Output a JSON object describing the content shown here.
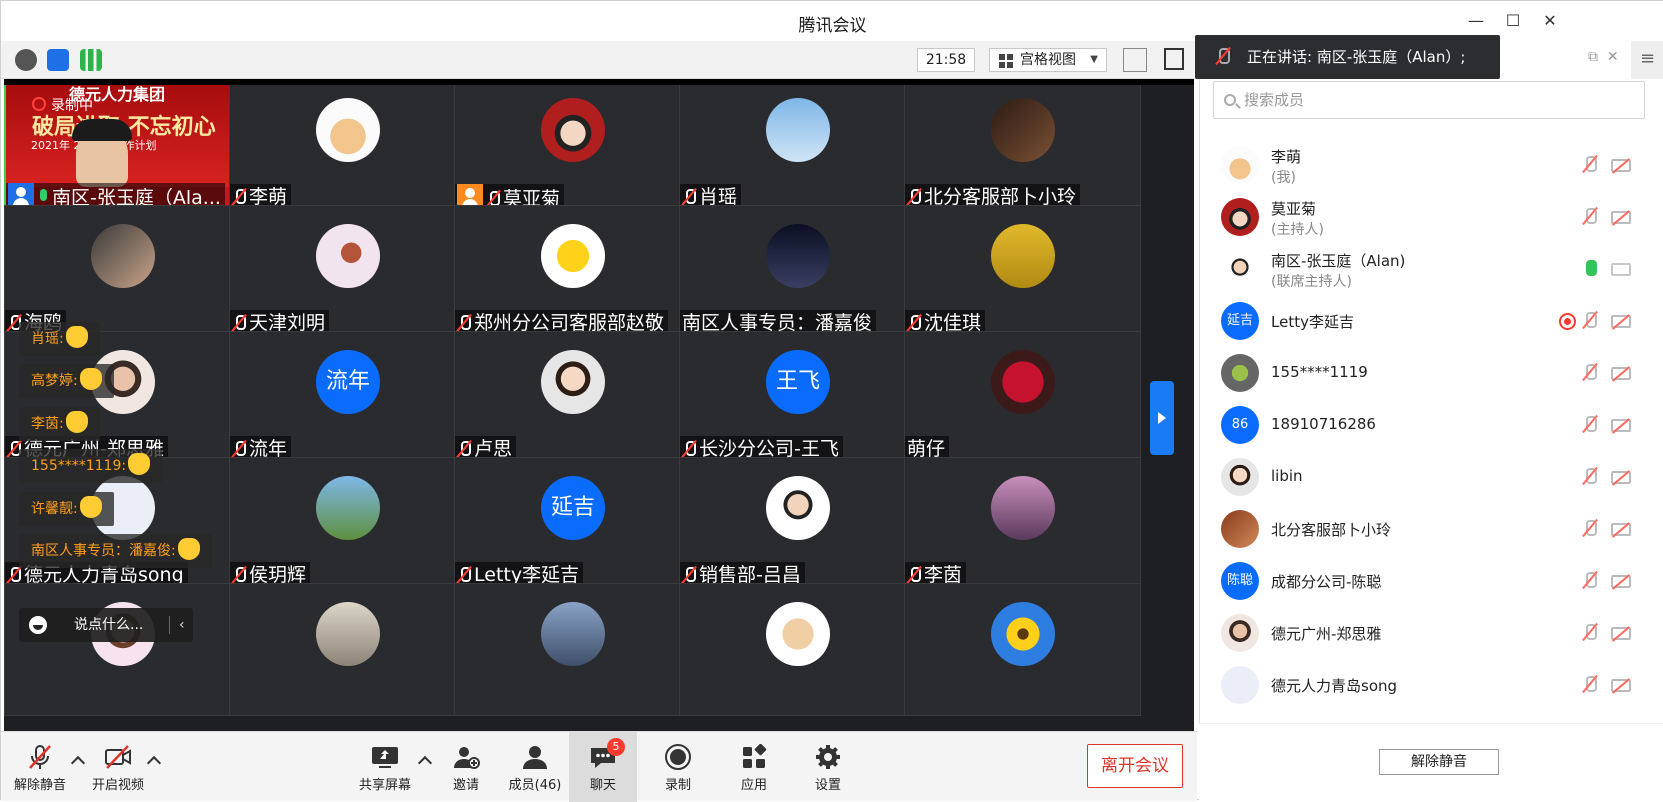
{
  "window": {
    "title": "腾讯会议"
  },
  "toolbar": {
    "time": "21:58",
    "view_label": "宫格视图"
  },
  "speaker_tile": {
    "banner_company": "德元人力集团",
    "banner_slogan": "破局进取  不忘初心",
    "banner_sub": "2021年         2022年工作计划",
    "recording": "录制中",
    "name": "南区-张玉庭（Ala..."
  },
  "tiles": [
    {
      "name": "李萌"
    },
    {
      "name": "莫亚菊"
    },
    {
      "name": "肖瑶"
    },
    {
      "name": "北分客服部卜小玲"
    },
    {
      "name": "海鸥"
    },
    {
      "name": "天津刘明"
    },
    {
      "name": "郑州分公司客服部赵敬"
    },
    {
      "name": "南区人事专员：潘嘉俊"
    },
    {
      "name": "沈佳琪"
    },
    {
      "name": "德元广州-郑思雅"
    },
    {
      "name": "流年",
      "avatar_text": "流年"
    },
    {
      "name": "卢思"
    },
    {
      "name": "长沙分公司-王飞",
      "avatar_text": "王飞"
    },
    {
      "name": "萌仔"
    },
    {
      "name": "德元人力青岛song"
    },
    {
      "name": "侯玥辉"
    },
    {
      "name": "Letty李延吉",
      "avatar_text": "延吉"
    },
    {
      "name": "销售部-吕昌"
    },
    {
      "name": "李茵"
    }
  ],
  "reactions": [
    {
      "text": "肖瑶:"
    },
    {
      "text": "高梦婷:"
    },
    {
      "text": "李茵:"
    },
    {
      "text": "155****1119:"
    },
    {
      "text": "许馨靓:"
    },
    {
      "text": "南区人事专员：潘嘉俊:"
    }
  ],
  "chat_input": {
    "placeholder": "说点什么..."
  },
  "bottom": {
    "unmute": "解除静音",
    "video": "开启视频",
    "share": "共享屏幕",
    "invite": "邀请",
    "members": "成员(46)",
    "chat": "聊天",
    "chat_badge": "5",
    "record": "录制",
    "apps": "应用",
    "settings": "设置",
    "leave": "离开会议"
  },
  "speaking_notice": "正在讲话: 南区-张玉庭（Alan）;",
  "member_panel": {
    "search_placeholder": "搜索成员",
    "members": [
      {
        "name": "李萌",
        "role": "(我)"
      },
      {
        "name": "莫亚菊",
        "role": "(主持人)"
      },
      {
        "name": "南区-张玉庭（Alan)",
        "role": "(联席主持人)"
      },
      {
        "name": "Letty李延吉",
        "avatar_text": "延吉"
      },
      {
        "name": "155****1119"
      },
      {
        "name": "18910716286",
        "avatar_text": "86"
      },
      {
        "name": "libin"
      },
      {
        "name": "北分客服部卜小玲"
      },
      {
        "name": "成都分公司-陈聪",
        "avatar_text": "陈聪"
      },
      {
        "name": "德元广州-郑思雅"
      },
      {
        "name": "德元人力青岛song"
      }
    ],
    "unmute_all": "解除静音"
  },
  "colors": {
    "accent_blue": "#0a6cff",
    "leave_red": "#e0342b",
    "active_speaker_green": "#3fcf4f"
  }
}
